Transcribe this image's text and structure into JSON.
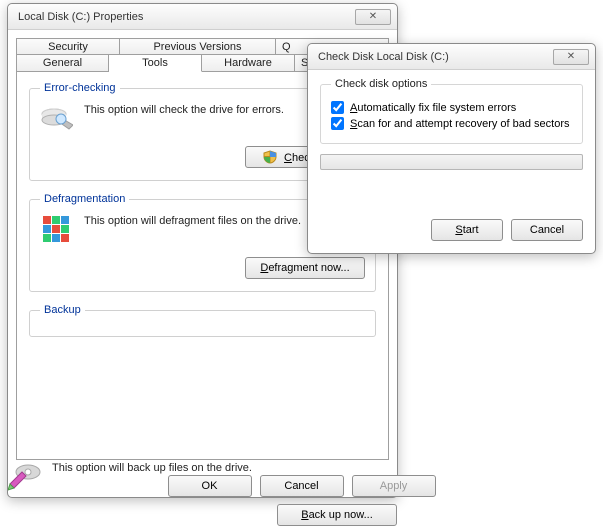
{
  "propwin": {
    "title": "Local Disk (C:) Properties",
    "tabs_back": [
      "Security",
      "Previous Versions",
      "Q"
    ],
    "tabs_front": [
      "General",
      "Tools",
      "Hardware",
      "S"
    ],
    "selected_tab": "Tools",
    "groups": {
      "error": {
        "legend": "Error-checking",
        "desc": "This option will check the drive for errors.",
        "button": "Check now..."
      },
      "defrag": {
        "legend": "Defragmentation",
        "desc": "This option will defragment files on the drive.",
        "button": "Defragment now..."
      },
      "backup": {
        "legend": "Backup",
        "desc": "This option will back up files on the drive.",
        "button": "Back up now..."
      }
    },
    "buttons": {
      "ok": "OK",
      "cancel": "Cancel",
      "apply": "Apply"
    }
  },
  "chkdlg": {
    "title": "Check Disk Local Disk (C:)",
    "group_legend": "Check disk options",
    "opt_autofix_pre": "A",
    "opt_autofix_rest": "utomatically fix file system errors",
    "opt_scan_pre": "S",
    "opt_scan_rest": "can for and attempt recovery of bad sectors",
    "opt_autofix_checked": true,
    "opt_scan_checked": true,
    "start_pre": "S",
    "start_rest": "tart",
    "cancel": "Cancel"
  }
}
